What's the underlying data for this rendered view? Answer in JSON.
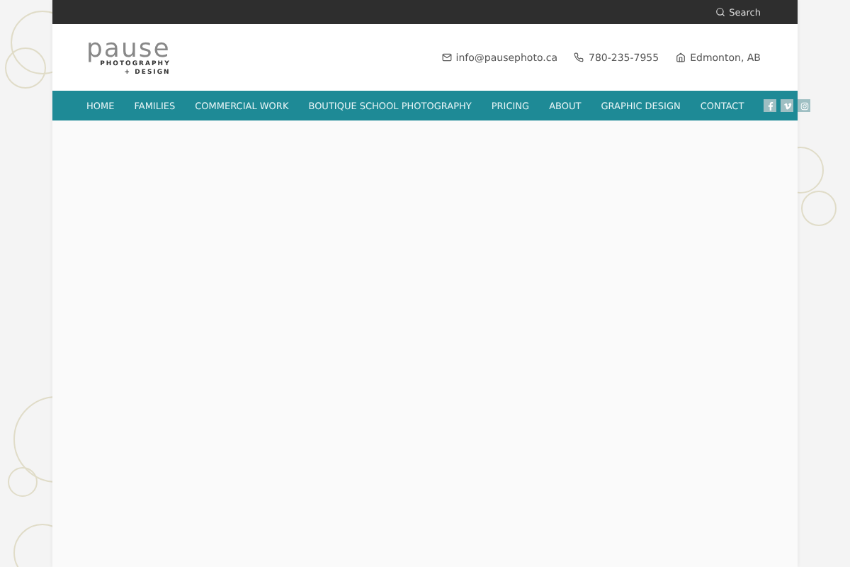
{
  "top_bar": {
    "search": "Search"
  },
  "logo": {
    "word": "pause",
    "line_1": "PHOTOGRAPHY",
    "line_2": "+ DESIGN"
  },
  "contacts": [
    {
      "kind": "email",
      "text": "info@pausephoto.ca"
    },
    {
      "kind": "phone",
      "text": "780-235-7955"
    },
    {
      "kind": "home",
      "text": "Edmonton, AB"
    }
  ],
  "nav": [
    "HOME",
    "FAMILIES",
    "COMMERCIAL WORK",
    "BOUTIQUE SCHOOL PHOTOGRAPHY",
    "PRICING",
    "ABOUT",
    "GRAPHIC DESIGN",
    "CONTACT"
  ],
  "social": [
    {
      "kind": "facebook"
    },
    {
      "kind": "vimeo"
    },
    {
      "kind": "instagram"
    }
  ]
}
